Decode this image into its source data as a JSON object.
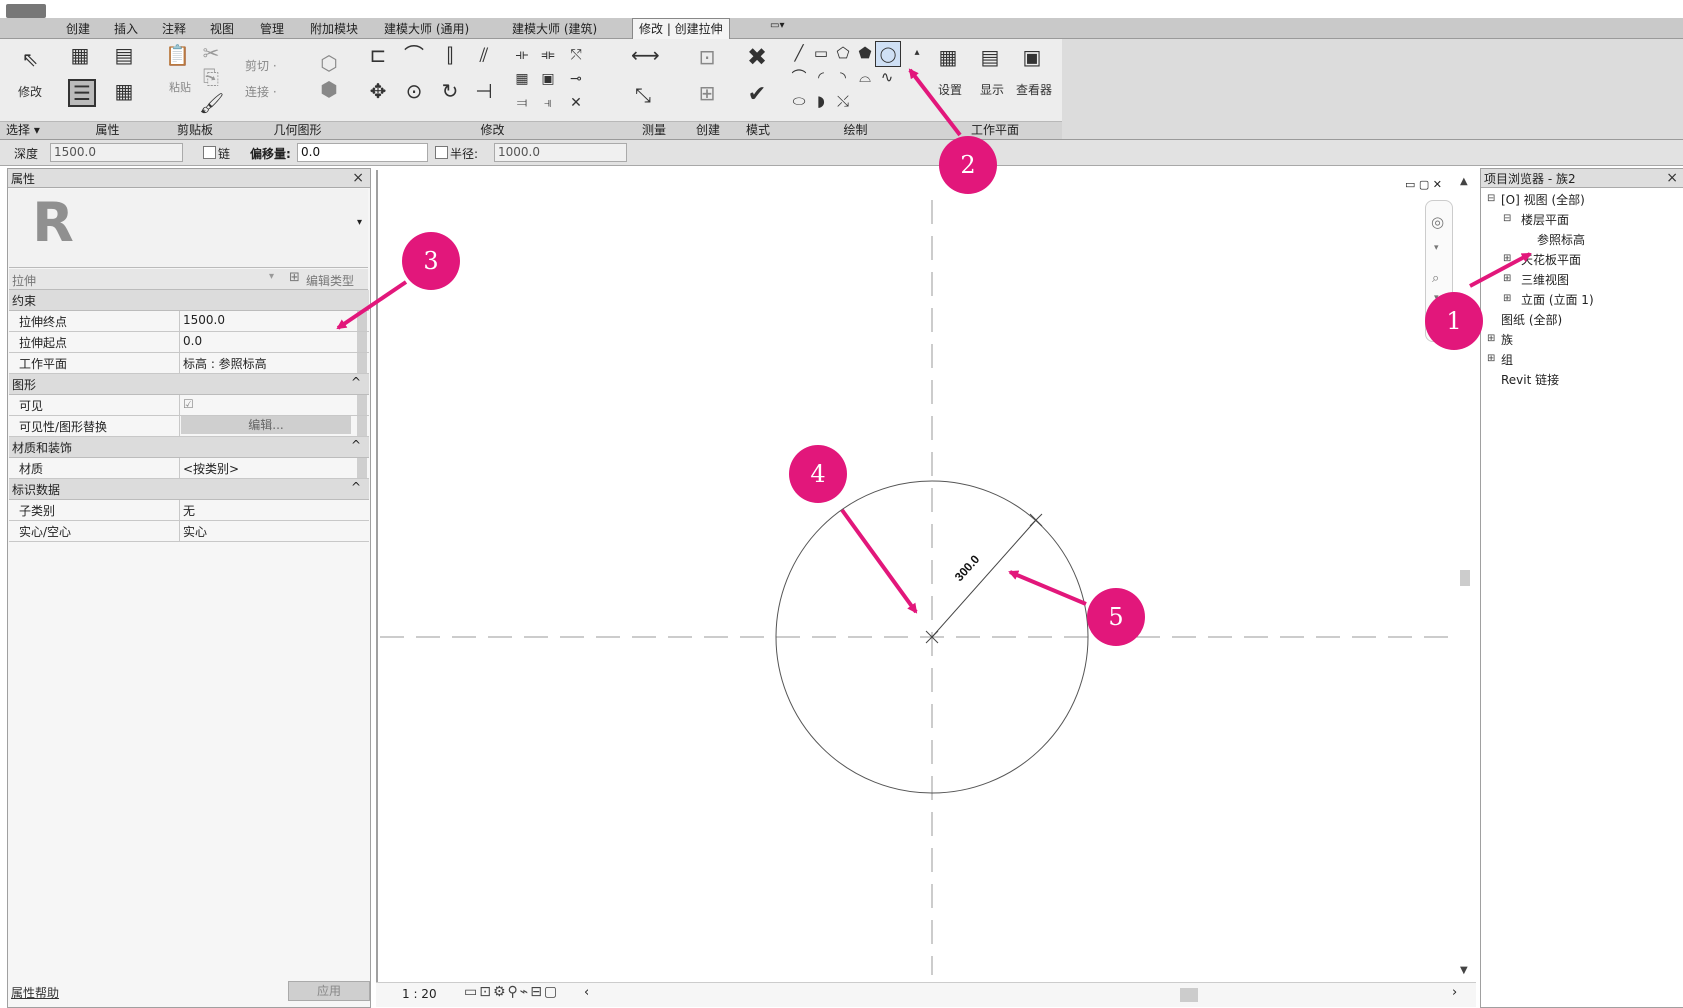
{
  "ribbon_tabs": [
    "创建",
    "插入",
    "注释",
    "视图",
    "管理",
    "附加模块",
    "建模大师 (通用)",
    "建模大师 (建筑)",
    "修改 | 创建拉伸"
  ],
  "ribbon": {
    "select_label": "选择 ▾",
    "modify_label": "修改",
    "properties_label": "属性",
    "clipboard_label": "剪贴板",
    "paste_label": "粘贴",
    "geometry_label": "几何图形",
    "cut_label": "剪切 ·",
    "join_label": "连接 ·",
    "modify_panel_label": "修改",
    "measure_label": "测量",
    "create_label": "创建",
    "mode_label": "模式",
    "draw_label": "绘制",
    "workplane_label": "工作平面",
    "set_label": "设置",
    "show_label": "显示",
    "viewer_label": "查看器"
  },
  "options_bar": {
    "depth_label": "深度",
    "depth_value": "1500.0",
    "chain_label": "链",
    "offset_label": "偏移量:",
    "offset_value": "0.0",
    "radius_label": "半径:",
    "radius_value": "1000.0"
  },
  "properties": {
    "title": "属性",
    "type_name": "拉伸",
    "edit_type": "编辑类型",
    "logo": "R",
    "groups": [
      {
        "name": "约束",
        "collapse": "",
        "rows": [
          {
            "key": "拉伸终点",
            "value": "1500.0"
          },
          {
            "key": "拉伸起点",
            "value": "0.0"
          },
          {
            "key": "工作平面",
            "value": "标高 : 参照标高"
          }
        ]
      },
      {
        "name": "图形",
        "collapse": "^",
        "rows": [
          {
            "key": "可见",
            "value": "☑"
          },
          {
            "key": "可见性/图形替换",
            "value": "编辑..."
          }
        ]
      },
      {
        "name": "材质和装饰",
        "collapse": "^",
        "rows": [
          {
            "key": "材质",
            "value": "<按类别>"
          }
        ]
      },
      {
        "name": "标识数据",
        "collapse": "^",
        "rows": [
          {
            "key": "子类别",
            "value": "无"
          },
          {
            "key": "实心/空心",
            "value": "实心"
          }
        ]
      }
    ],
    "help_link": "属性帮助",
    "apply_button": "应用"
  },
  "canvas": {
    "dimension_label": "300.0",
    "scale": "1 : 20"
  },
  "browser": {
    "title": "项目浏览器 - 族2",
    "items": [
      {
        "text": "[O] 视图 (全部)",
        "toggle": "⊟"
      },
      {
        "text": "楼层平面",
        "toggle": "⊟"
      },
      {
        "text": "参照标高",
        "toggle": ""
      },
      {
        "text": "天花板平面",
        "toggle": "⊞"
      },
      {
        "text": "三维视图",
        "toggle": "⊞"
      },
      {
        "text": "立面 (立面 1)",
        "toggle": "⊞"
      },
      {
        "text": "图纸 (全部)",
        "toggle": ""
      },
      {
        "text": "族",
        "toggle": "⊞"
      },
      {
        "text": "组",
        "toggle": "⊞"
      },
      {
        "text": "Revit 链接",
        "toggle": ""
      }
    ]
  },
  "callouts": [
    "1",
    "2",
    "3",
    "4",
    "5"
  ],
  "colors": {
    "callout": "#e2177b",
    "arrow": "#e2177b"
  }
}
